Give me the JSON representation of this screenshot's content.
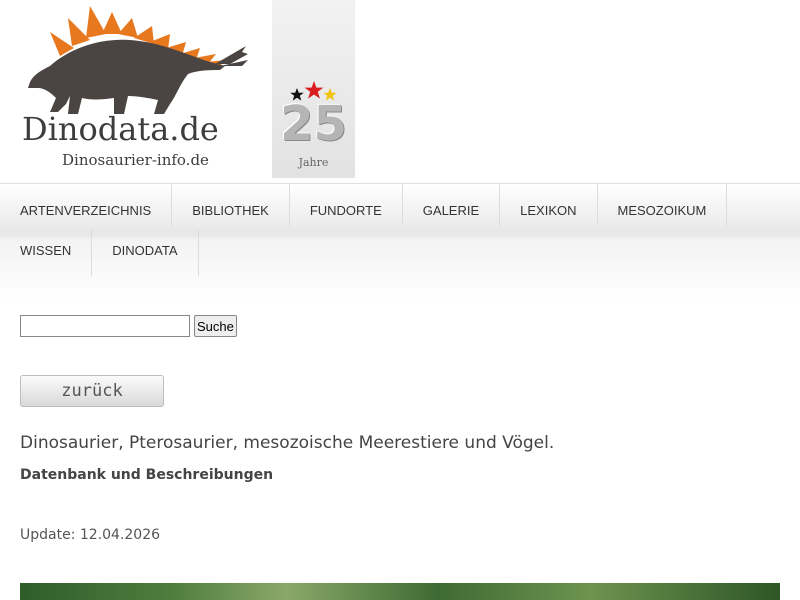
{
  "logo": {
    "title": "Dinodata.de",
    "subtitle": "Dinosaurier-info.de",
    "mascot_icon": "stegosaurus-icon",
    "badge": {
      "number": "25",
      "label": "Jahre",
      "star_colors": [
        "#111111",
        "#d81e1e",
        "#f1c40f"
      ]
    }
  },
  "nav": {
    "row1": [
      "ARTENVERZEICHNIS",
      "BIBLIOTHEK",
      "FUNDORTE",
      "GALERIE",
      "LEXIKON",
      "MESOZOIKUM"
    ],
    "row2": [
      "WISSEN",
      "DINODATA"
    ]
  },
  "search": {
    "value": "",
    "placeholder": "",
    "button_label": "Suche"
  },
  "back_button": {
    "label": "zurück"
  },
  "content": {
    "lead": "Dinosaurier, Pterosaurier, mesozoische Meerestiere und Vögel.",
    "subheading": "Datenbank und Beschreibungen",
    "update": "Update: 12.04.2026"
  },
  "colors": {
    "dino_body": "#4a4543",
    "dino_plates": "#e8781e",
    "text": "#444444"
  }
}
